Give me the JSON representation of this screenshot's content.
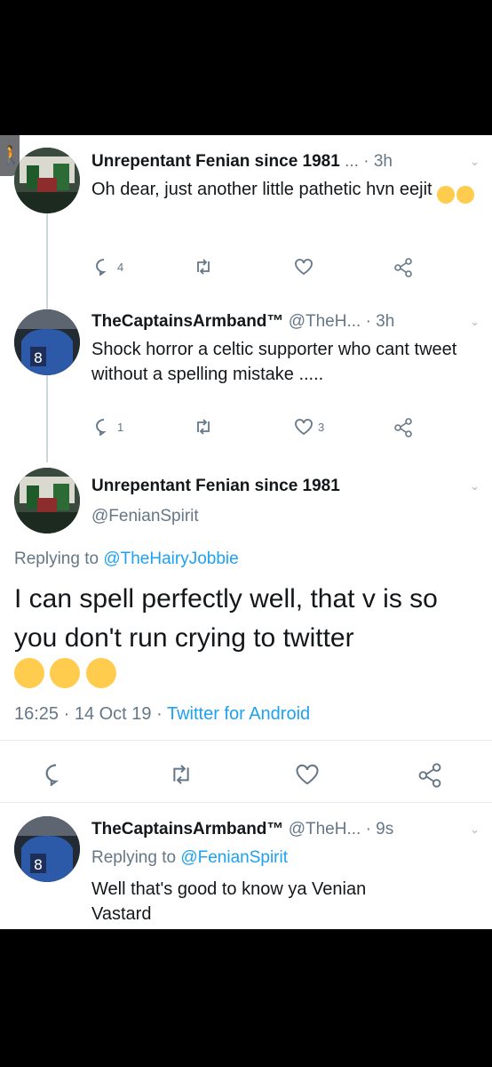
{
  "tweets": [
    {
      "display_name": "Unrepentant Fenian since 1981",
      "handle": "...",
      "time": "· 3h",
      "text": "Oh dear, just another little pathetic hvn eejit",
      "emoji": "🤦‍♂️😂",
      "replies": "4",
      "retweets": "",
      "likes": ""
    },
    {
      "display_name": "TheCaptainsArmband™",
      "handle": "@TheH...",
      "time": "· 3h",
      "text": "Shock horror a celtic supporter  who cant tweet without a spelling mistake .....",
      "replies": "1",
      "retweets": "",
      "likes": "3"
    },
    {
      "display_name": "Unrepentant Fenian since 1981",
      "handle": "@FenianSpirit",
      "replying_prefix": "Replying to",
      "replying_to": "@TheHairyJobbie",
      "text": "I can spell perfectly well, that v is so you don't run crying to twitter",
      "emoji": "😉😂😂",
      "timestamp": "16:25 · 14 Oct 19 ·",
      "client": "Twitter for Android"
    },
    {
      "display_name": "TheCaptainsArmband™",
      "handle": "@TheH...",
      "time": "· 9s",
      "replying_prefix": "Replying to",
      "replying_to": "@FenianSpirit",
      "text": "Well that's good to know ya Venian Vastard"
    }
  ],
  "icons": [
    "accessibility-icon",
    "reply-icon",
    "retweet-icon",
    "like-icon",
    "share-icon",
    "chevron-down-icon"
  ],
  "colors": {
    "link": "#1da1f2",
    "muted": "#657786",
    "text": "#14171a",
    "background": "#000000",
    "card": "#ffffff"
  }
}
